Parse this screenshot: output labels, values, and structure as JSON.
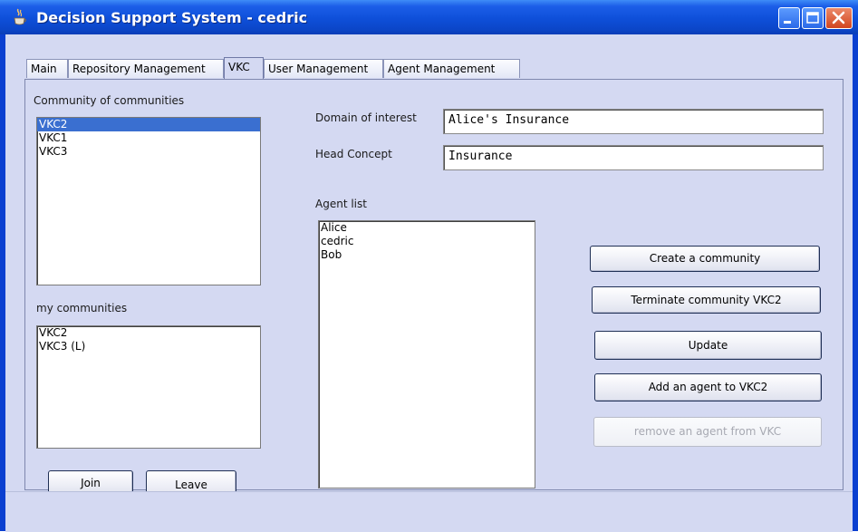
{
  "window": {
    "title": "Decision Support System - cedric",
    "icon": "java-coffee-cup-icon"
  },
  "tabs": [
    {
      "label": "Main",
      "active": false
    },
    {
      "label": "Repository Management",
      "active": false
    },
    {
      "label": "VKC",
      "active": true
    },
    {
      "label": "User Management",
      "active": false
    },
    {
      "label": "Agent Management",
      "active": false
    }
  ],
  "left": {
    "communities_label": "Community of communities",
    "communities": [
      "VKC2",
      "VKC1",
      "VKC3"
    ],
    "selected_community": "VKC2",
    "my_communities_label": "my communities",
    "my_communities": [
      "VKC2",
      "VKC3 (L)"
    ],
    "join_label": "Join",
    "leave_label": "Leave"
  },
  "form": {
    "domain_label": "Domain of interest",
    "domain_value": "Alice's Insurance",
    "head_concept_label": "Head Concept",
    "head_concept_value": "Insurance"
  },
  "agents": {
    "label": "Agent list",
    "items": [
      "Alice",
      "cedric",
      "Bob"
    ]
  },
  "actions": {
    "create_label": "Create a community",
    "terminate_label": "Terminate community VKC2",
    "update_label": "Update",
    "add_agent_label": "Add an agent to VKC2",
    "remove_agent_label": "remove an agent from VKC",
    "remove_agent_enabled": false
  },
  "colors": {
    "title_bar": "#0e4fd9",
    "selection": "#3a6fd0",
    "panel_bg": "#d4d9f2",
    "close_button": "#d2451f"
  }
}
